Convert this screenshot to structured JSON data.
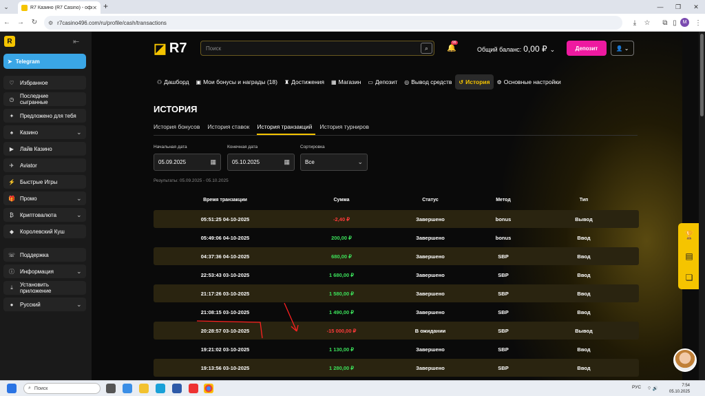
{
  "browser": {
    "tab_title": "R7 Казино (R7 Casino) - офици...",
    "tab_close": "✕",
    "new_tab": "+",
    "url": "r7casino496.com/ru/profile/cash/transactions",
    "profile_initial": "M"
  },
  "header": {
    "logo_text": "R7",
    "search_placeholder": "Поиск",
    "notifications_badge": "99",
    "balance_label": "Общий баланс:",
    "balance_value": "0,00 ₽",
    "deposit_label": "Депозит"
  },
  "sidebar": {
    "telegram": "Telegram",
    "items": [
      {
        "label": "Избранное",
        "icon": "heart-icon",
        "chev": ""
      },
      {
        "label": "Последние сыгранные",
        "icon": "clock-icon",
        "chev": ""
      },
      {
        "label": "Предложено для тебя",
        "icon": "star-icon",
        "chev": ""
      },
      {
        "label": "Казино",
        "icon": "casino-icon",
        "chev": "⌄"
      },
      {
        "label": "Лайв Казино",
        "icon": "live-icon",
        "chev": ""
      },
      {
        "label": "Aviator",
        "icon": "plane-icon",
        "chev": ""
      },
      {
        "label": "Быстрые Игры",
        "icon": "lightning-icon",
        "chev": ""
      },
      {
        "label": "Промо",
        "icon": "gift-icon",
        "chev": "⌄"
      },
      {
        "label": "Криптовалюта",
        "icon": "crypto-icon",
        "chev": "⌄"
      },
      {
        "label": "Королевский Куш",
        "icon": "diamond-icon",
        "chev": ""
      },
      {
        "label": "Поддержка",
        "icon": "support-icon",
        "chev": ""
      },
      {
        "label": "Информация",
        "icon": "info-icon",
        "chev": "⌄"
      },
      {
        "label": "Установить приложение",
        "icon": "download-icon",
        "chev": ""
      },
      {
        "label": "Русский",
        "icon": "flag-ru-icon",
        "chev": "⌄"
      }
    ]
  },
  "menu": [
    {
      "label": "Дашборд",
      "icon": "user-icon"
    },
    {
      "label": "Мои бонусы и награды (18)",
      "icon": "gift-icon"
    },
    {
      "label": "Достижения",
      "icon": "trophy-icon"
    },
    {
      "label": "Магазин",
      "icon": "shop-icon"
    },
    {
      "label": "Депозит",
      "icon": "wallet-icon"
    },
    {
      "label": "Вывод средств",
      "icon": "coins-icon"
    },
    {
      "label": "История",
      "icon": "history-icon"
    },
    {
      "label": "Основные настройки",
      "icon": "gear-icon"
    }
  ],
  "page_title": "ИСТОРИЯ",
  "subtabs": [
    "История бонусов",
    "История ставок",
    "История транзакций",
    "История турниров"
  ],
  "filters": {
    "start_label": "Начальная дата",
    "start_value": "05.09.2025",
    "end_label": "Конечная дата",
    "end_value": "05.10.2025",
    "sort_label": "Сортировка",
    "sort_value": "Все",
    "results_text": "Результаты: 05.09.2025 - 05.10.2025"
  },
  "table": {
    "headers": [
      "Время транзакции",
      "Сумма",
      "Статус",
      "Метод",
      "Тип"
    ],
    "rows": [
      {
        "time": "05:51:25 04-10-2025",
        "amount": "-2,40 ₽",
        "status": "Завершено",
        "method": "bonus",
        "type": "Вывод",
        "neg": true
      },
      {
        "time": "05:49:06 04-10-2025",
        "amount": "200,00 ₽",
        "status": "Завершено",
        "method": "bonus",
        "type": "Ввод",
        "neg": false
      },
      {
        "time": "04:37:36 04-10-2025",
        "amount": "680,00 ₽",
        "status": "Завершено",
        "method": "SBP",
        "type": "Ввод",
        "neg": false
      },
      {
        "time": "22:53:43 03-10-2025",
        "amount": "1 680,00 ₽",
        "status": "Завершено",
        "method": "SBP",
        "type": "Ввод",
        "neg": false
      },
      {
        "time": "21:17:26 03-10-2025",
        "amount": "1 580,00 ₽",
        "status": "Завершено",
        "method": "SBP",
        "type": "Ввод",
        "neg": false
      },
      {
        "time": "21:08:15 03-10-2025",
        "amount": "1 490,00 ₽",
        "status": "Завершено",
        "method": "SBP",
        "type": "Ввод",
        "neg": false
      },
      {
        "time": "20:28:57 03-10-2025",
        "amount": "-15 000,00 ₽",
        "status": "В ожидании",
        "method": "SBP",
        "type": "Вывод",
        "neg": true
      },
      {
        "time": "19:21:02 03-10-2025",
        "amount": "1 130,00 ₽",
        "status": "Завершено",
        "method": "SBP",
        "type": "Ввод",
        "neg": false
      },
      {
        "time": "19:13:56 03-10-2025",
        "amount": "1 280,00 ₽",
        "status": "Завершено",
        "method": "SBP",
        "type": "Ввод",
        "neg": false
      }
    ]
  },
  "taskbar": {
    "search_placeholder": "Поиск",
    "lang": "РУС",
    "time": "7:54",
    "date": "05.10.2025"
  },
  "colors": {
    "accent": "#f5c400",
    "deposit": "#ee1aa0",
    "negative": "#ff3a3a",
    "positive": "#3ce05a"
  }
}
